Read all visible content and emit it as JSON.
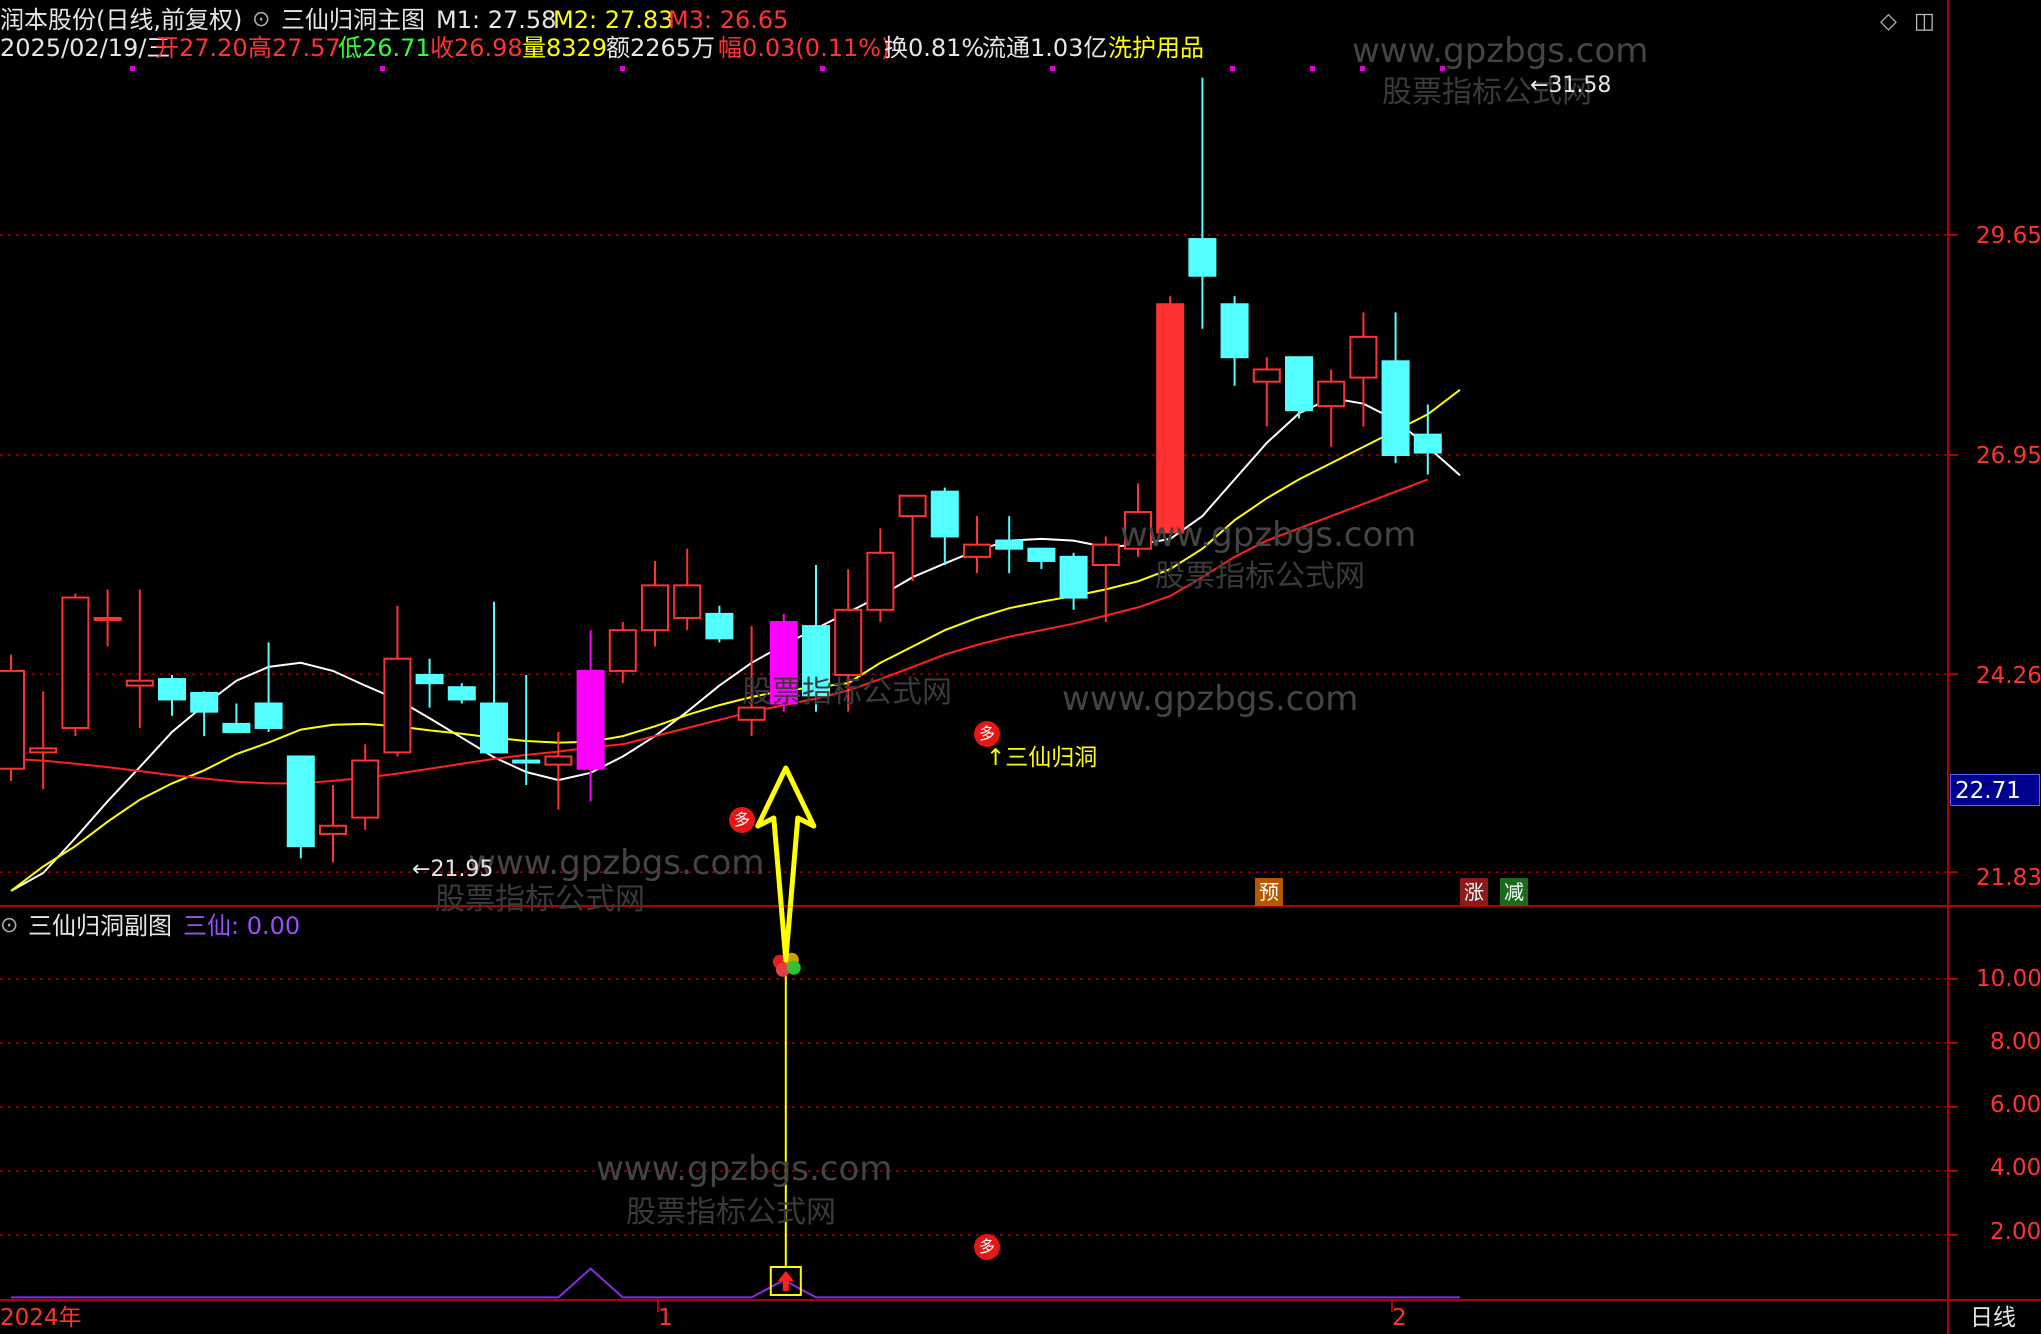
{
  "header": {
    "stock_name": "润本股份(日线,前复权)",
    "indicator_name": "三仙归洞主图",
    "m1": "M1: 27.58",
    "m2": "M2: 27.83",
    "m3": "M3: 26.65",
    "date": "2025/02/19/三",
    "open": "开27.20",
    "high": "高27.57",
    "low": "低26.71",
    "close": "收26.98",
    "volume": "量8329",
    "amount": "额2265万",
    "change": "幅0.03(0.11%)",
    "turnover": "换0.81%",
    "float_cap": "流通1.03亿",
    "sector": "洗护用品"
  },
  "sub_header": {
    "indicator_name": "三仙归洞副图",
    "value_label": "三仙: 0.00"
  },
  "annotations": {
    "high_mark": "31.58",
    "low_mark": "21.95",
    "signal_text": "三仙归洞",
    "badge_duo": "多",
    "badge_yu": "预",
    "badge_zhang": "涨",
    "badge_jian": "减",
    "price_box": "22.71"
  },
  "watermarks": {
    "url": "www.gpzbgs.com",
    "name": "股票指标公式网"
  },
  "x_axis": {
    "labels": [
      "2024年",
      "1",
      "2"
    ],
    "period": "日线"
  },
  "colors": {
    "up": "#ff3232",
    "down": "#54ffff",
    "magenta": "#ff00ff",
    "ma_white": "#ffffff",
    "ma_yellow": "#ffff00",
    "ma_red": "#ff2020",
    "grid": "#8b0000",
    "sub_line": "#8a2be2"
  },
  "chart_data": [
    {
      "type": "candlestick",
      "y_ticks": [
        "29.65",
        "26.95",
        "24.26",
        "21.83"
      ],
      "ylim": [
        21.4,
        32.0
      ],
      "candles": [
        {
          "o": 23.1,
          "h": 24.5,
          "l": 22.95,
          "c": 24.3
        },
        {
          "o": 23.3,
          "h": 24.05,
          "l": 22.85,
          "c": 23.35
        },
        {
          "o": 23.6,
          "h": 25.25,
          "l": 23.5,
          "c": 25.2
        },
        {
          "o": 24.95,
          "h": 25.3,
          "l": 24.6,
          "c": 24.95
        },
        {
          "o": 24.12,
          "h": 25.3,
          "l": 23.6,
          "c": 24.18
        },
        {
          "o": 24.2,
          "h": 24.25,
          "l": 23.75,
          "c": 23.95
        },
        {
          "o": 24.03,
          "h": 24.05,
          "l": 23.5,
          "c": 23.8
        },
        {
          "o": 23.65,
          "h": 23.9,
          "l": 23.55,
          "c": 23.55
        },
        {
          "o": 23.9,
          "h": 24.65,
          "l": 23.55,
          "c": 23.6
        },
        {
          "o": 23.25,
          "h": 23.25,
          "l": 22.0,
          "c": 22.15
        },
        {
          "o": 22.3,
          "h": 22.9,
          "l": 21.95,
          "c": 22.4
        },
        {
          "o": 22.5,
          "h": 23.4,
          "l": 22.35,
          "c": 23.2
        },
        {
          "o": 23.3,
          "h": 25.1,
          "l": 23.25,
          "c": 24.45
        },
        {
          "o": 24.25,
          "h": 24.45,
          "l": 23.85,
          "c": 24.15
        },
        {
          "o": 24.1,
          "h": 24.15,
          "l": 23.9,
          "c": 23.95
        },
        {
          "o": 23.9,
          "h": 25.15,
          "l": 23.75,
          "c": 23.3
        },
        {
          "o": 23.2,
          "h": 24.25,
          "l": 22.9,
          "c": 23.18
        },
        {
          "o": 23.15,
          "h": 23.55,
          "l": 22.6,
          "c": 23.25
        },
        {
          "o": 23.1,
          "h": 24.8,
          "l": 22.7,
          "c": 24.3,
          "color": "magenta"
        },
        {
          "o": 24.3,
          "h": 24.9,
          "l": 24.15,
          "c": 24.8
        },
        {
          "o": 24.8,
          "h": 25.65,
          "l": 24.6,
          "c": 25.35
        },
        {
          "o": 24.95,
          "h": 25.8,
          "l": 24.8,
          "c": 25.35
        },
        {
          "o": 25.0,
          "h": 25.1,
          "l": 24.65,
          "c": 24.7
        },
        {
          "o": 23.7,
          "h": 24.85,
          "l": 23.5,
          "c": 23.85
        },
        {
          "o": 23.9,
          "h": 25.0,
          "l": 23.8,
          "c": 24.9,
          "color": "magenta"
        },
        {
          "o": 24.85,
          "h": 25.6,
          "l": 23.8,
          "c": 24.0
        },
        {
          "o": 24.25,
          "h": 25.55,
          "l": 23.8,
          "c": 25.05
        },
        {
          "o": 25.05,
          "h": 26.05,
          "l": 24.9,
          "c": 25.75
        },
        {
          "o": 26.2,
          "h": 26.45,
          "l": 25.4,
          "c": 26.45
        },
        {
          "o": 26.5,
          "h": 26.55,
          "l": 25.6,
          "c": 25.95
        },
        {
          "o": 25.7,
          "h": 26.2,
          "l": 25.5,
          "c": 25.85
        },
        {
          "o": 25.9,
          "h": 26.2,
          "l": 25.5,
          "c": 25.8
        },
        {
          "o": 25.8,
          "h": 25.8,
          "l": 25.55,
          "c": 25.65
        },
        {
          "o": 25.7,
          "h": 25.75,
          "l": 25.05,
          "c": 25.2
        },
        {
          "o": 25.6,
          "h": 25.95,
          "l": 24.9,
          "c": 25.85
        },
        {
          "o": 25.8,
          "h": 26.6,
          "l": 25.7,
          "c": 26.25
        },
        {
          "o": 26.0,
          "h": 28.9,
          "l": 26.0,
          "c": 28.8
        },
        {
          "o": 29.6,
          "h": 31.58,
          "l": 28.5,
          "c": 29.15
        },
        {
          "o": 28.8,
          "h": 28.9,
          "l": 27.8,
          "c": 28.15
        },
        {
          "o": 27.85,
          "h": 28.15,
          "l": 27.3,
          "c": 28.0
        },
        {
          "o": 28.15,
          "h": 28.15,
          "l": 27.4,
          "c": 27.5
        },
        {
          "o": 27.55,
          "h": 28.0,
          "l": 27.05,
          "c": 27.85
        },
        {
          "o": 27.9,
          "h": 28.7,
          "l": 27.3,
          "c": 28.4
        },
        {
          "o": 28.1,
          "h": 28.7,
          "l": 26.85,
          "c": 26.95
        },
        {
          "o": 27.2,
          "h": 27.57,
          "l": 26.71,
          "c": 26.98
        }
      ],
      "series": [
        {
          "values": [
            21.6,
            21.82,
            22.25,
            22.7,
            23.12,
            23.55,
            23.88,
            24.18,
            24.35,
            24.4,
            24.3,
            24.12,
            23.95,
            23.72,
            23.48,
            23.24,
            23.06,
            22.96,
            23.05,
            23.25,
            23.5,
            23.8,
            24.12,
            24.4,
            24.62,
            24.82,
            25.02,
            25.22,
            25.45,
            25.62,
            25.78,
            25.9,
            25.92,
            25.9,
            25.82,
            25.85,
            25.92,
            26.2,
            26.65,
            27.1,
            27.46,
            27.65,
            27.58,
            27.38,
            27.05,
            26.7
          ]
        },
        {
          "values": [
            21.6,
            21.9,
            22.15,
            22.45,
            22.72,
            22.92,
            23.08,
            23.28,
            23.42,
            23.58,
            23.64,
            23.65,
            23.62,
            23.57,
            23.53,
            23.48,
            23.44,
            23.42,
            23.43,
            23.5,
            23.62,
            23.76,
            23.88,
            23.98,
            24.06,
            24.1,
            24.15,
            24.4,
            24.6,
            24.8,
            24.95,
            25.07,
            25.15,
            25.22,
            25.3,
            25.4,
            25.55,
            25.8,
            26.15,
            26.42,
            26.65,
            26.85,
            27.05,
            27.25,
            27.45,
            27.75
          ]
        },
        {
          "values": [
            23.22,
            23.2,
            23.16,
            23.12,
            23.07,
            23.02,
            22.98,
            22.94,
            22.92,
            22.92,
            22.95,
            22.99,
            23.04,
            23.1,
            23.16,
            23.22,
            23.27,
            23.31,
            23.36,
            23.4,
            23.5,
            23.6,
            23.7,
            23.8,
            23.88,
            23.96,
            24.06,
            24.2,
            24.35,
            24.5,
            24.62,
            24.72,
            24.8,
            24.88,
            24.98,
            25.08,
            25.22,
            25.45,
            25.7,
            25.9,
            26.05,
            26.2,
            26.35,
            26.5,
            26.65
          ]
        }
      ]
    },
    {
      "type": "line",
      "y_ticks": [
        "10.00",
        "8.00",
        "6.00",
        "4.00",
        "2.00"
      ],
      "ylim": [
        0,
        11.4
      ],
      "series": [
        {
          "name": "三仙",
          "values": [
            0,
            0,
            0,
            0,
            0,
            0,
            0,
            0,
            0,
            0,
            0,
            0,
            0,
            0,
            0,
            0,
            0,
            0,
            1.0,
            0,
            0,
            0,
            0,
            0,
            0.6,
            0,
            0,
            0,
            0,
            0,
            0,
            0,
            0,
            0,
            0,
            0,
            0,
            0,
            0,
            0,
            0,
            0,
            0,
            0,
            0,
            0
          ]
        }
      ],
      "signal_line_value": 10.35
    }
  ]
}
